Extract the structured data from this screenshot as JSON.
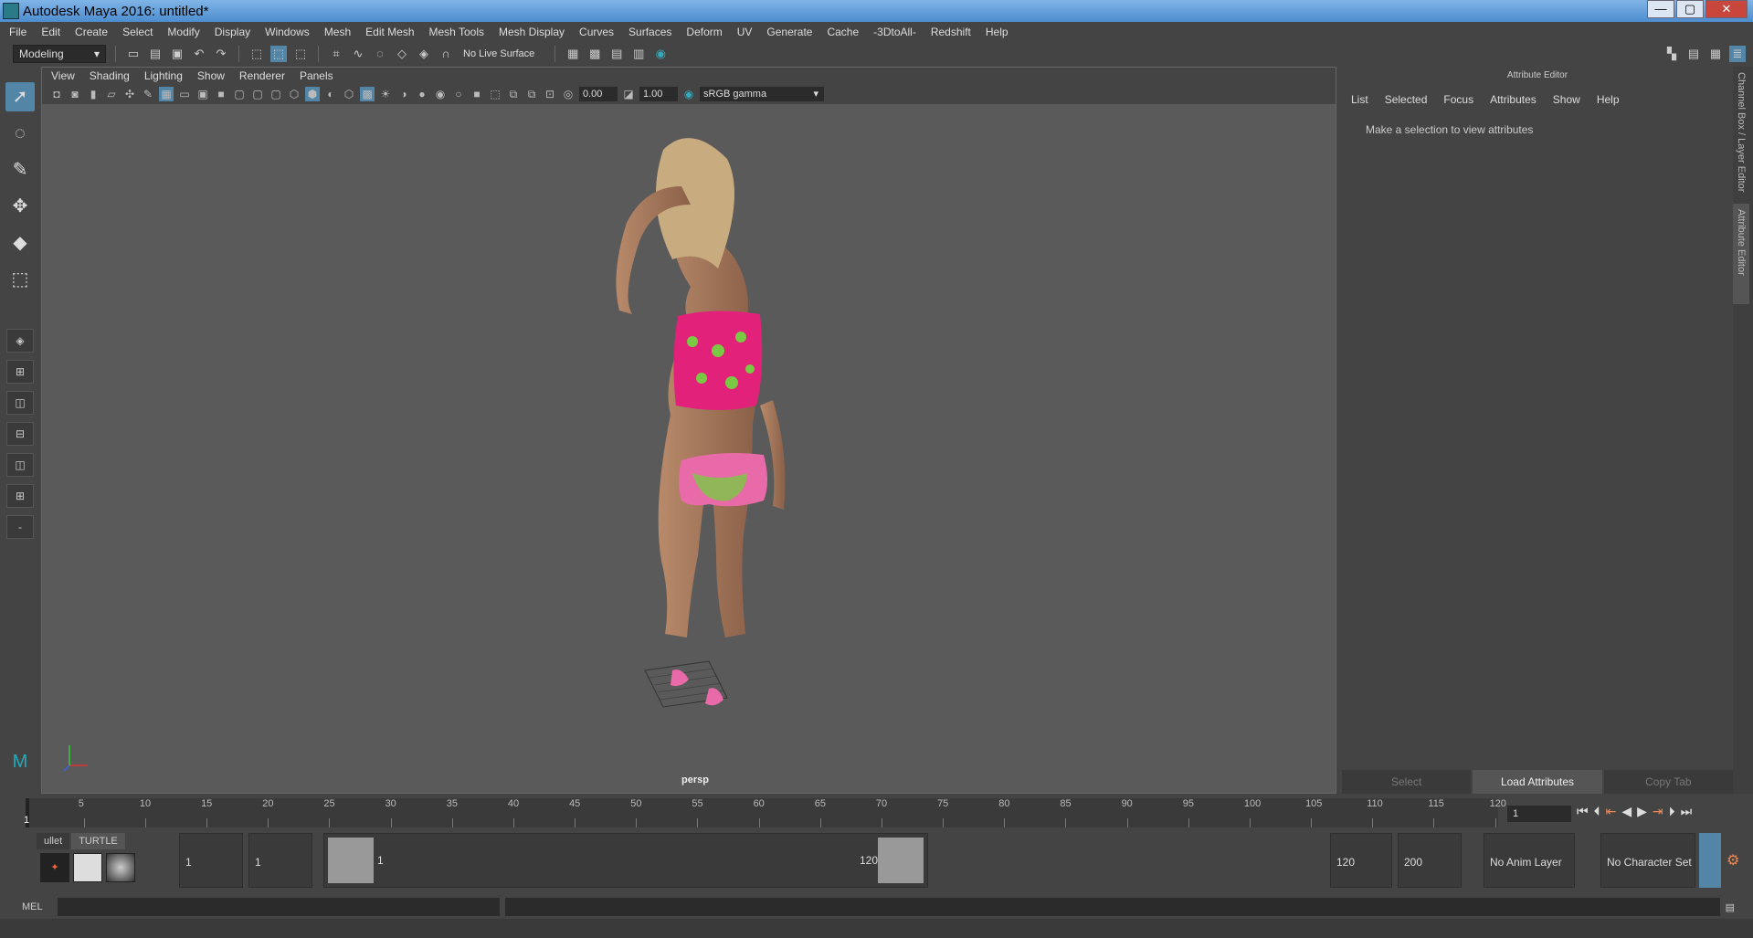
{
  "window": {
    "title": "Autodesk Maya 2016: untitled*",
    "min": "—",
    "max": "▢",
    "close": "✕"
  },
  "menu": [
    "File",
    "Edit",
    "Create",
    "Select",
    "Modify",
    "Display",
    "Windows",
    "Mesh",
    "Edit Mesh",
    "Mesh Tools",
    "Mesh Display",
    "Curves",
    "Surfaces",
    "Deform",
    "UV",
    "Generate",
    "Cache",
    "-3DtoAll-",
    "Redshift",
    "Help"
  ],
  "toolbar": {
    "mode": "Modeling",
    "live_surface": "No Live Surface"
  },
  "viewport": {
    "menu": [
      "View",
      "Shading",
      "Lighting",
      "Show",
      "Renderer",
      "Panels"
    ],
    "exposure": "0.00",
    "gamma": "1.00",
    "color_space": "sRGB gamma",
    "camera": "persp"
  },
  "attribute_editor": {
    "title": "Attribute Editor",
    "menu": [
      "List",
      "Selected",
      "Focus",
      "Attributes",
      "Show",
      "Help"
    ],
    "message": "Make a selection to view attributes",
    "buttons": {
      "select": "Select",
      "load": "Load Attributes",
      "copy": "Copy Tab"
    }
  },
  "side_tabs": {
    "channel": "Channel Box / Layer Editor",
    "attr": "Attribute Editor"
  },
  "timeline": {
    "ticks": [
      "5",
      "10",
      "15",
      "20",
      "25",
      "30",
      "35",
      "40",
      "45",
      "50",
      "55",
      "60",
      "65",
      "70",
      "75",
      "80",
      "85",
      "90",
      "95",
      "100",
      "105",
      "110",
      "115",
      "120"
    ],
    "start_marker": "1",
    "current_frame": "1"
  },
  "range": {
    "shelf_tabs": [
      "ullet",
      "TURTLE"
    ],
    "start": "1",
    "playback_start": "1",
    "slider_start": "1",
    "slider_end": "120",
    "playback_end": "120",
    "end": "200",
    "anim_layer": "No Anim Layer",
    "char_set": "No Character Set"
  },
  "command": {
    "label": "MEL"
  }
}
